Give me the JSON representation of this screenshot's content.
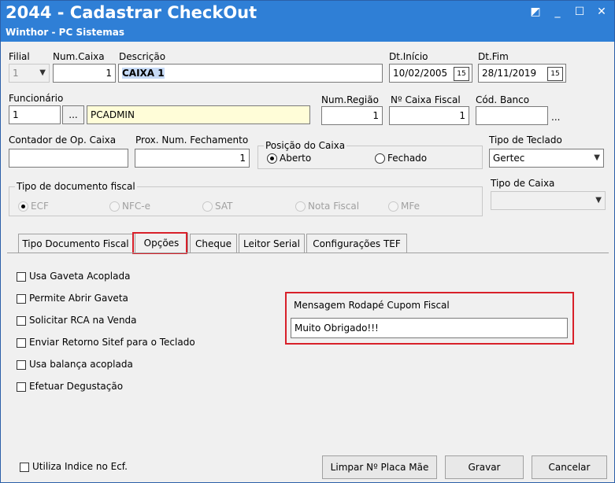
{
  "window": {
    "title": "2044 - Cadastrar CheckOut",
    "subtitle": "Winthor - PC Sistemas",
    "controls": [
      "◩",
      "_",
      "☐",
      "✕"
    ]
  },
  "fields": {
    "filial": {
      "label": "Filial",
      "value": "1"
    },
    "num_caixa": {
      "label": "Num.Caixa",
      "value": "1"
    },
    "descricao": {
      "label": "Descrição",
      "value": "CAIXA 1"
    },
    "dt_inicio": {
      "label": "Dt.Início",
      "value": "10/02/2005"
    },
    "dt_fim": {
      "label": "Dt.Fim",
      "value": "28/11/2019"
    },
    "funcionario": {
      "label": "Funcionário",
      "code": "1",
      "lookup_btn": "...",
      "name": "PCADMIN"
    },
    "num_regiao": {
      "label": "Num.Região",
      "value": "1"
    },
    "num_caixa_fiscal": {
      "label": "Nº Caixa Fiscal",
      "value": "1"
    },
    "cod_banco": {
      "label": "Cód. Banco",
      "value": "",
      "lookup": "..."
    },
    "contador_op_caixa": {
      "label": "Contador de Op. Caixa",
      "value": ""
    },
    "prox_num_fechamento": {
      "label": "Prox. Num. Fechamento",
      "value": "1"
    },
    "tipo_teclado": {
      "label": "Tipo de Teclado",
      "value": "Gertec"
    },
    "tipo_caixa": {
      "label": "Tipo de Caixa",
      "value": ""
    }
  },
  "posicao_caixa": {
    "label": "Posição do Caixa",
    "options": [
      {
        "label": "Aberto",
        "selected": true
      },
      {
        "label": "Fechado",
        "selected": false
      }
    ]
  },
  "tipo_documento_fiscal": {
    "label": "Tipo de documento fiscal",
    "options": [
      {
        "label": "ECF",
        "selected": true
      },
      {
        "label": "NFC-e",
        "selected": false
      },
      {
        "label": "SAT",
        "selected": false
      },
      {
        "label": "Nota Fiscal",
        "selected": false
      },
      {
        "label": "MFe",
        "selected": false
      }
    ]
  },
  "tabs": [
    {
      "label": "Tipo Documento Fiscal",
      "active": false
    },
    {
      "label": "Opções",
      "active": true
    },
    {
      "label": "Cheque",
      "active": false
    },
    {
      "label": "Leitor Serial",
      "active": false
    },
    {
      "label": "Configurações TEF",
      "active": false
    }
  ],
  "opcoes": {
    "checkboxes": [
      {
        "label": "Usa Gaveta Acoplada",
        "checked": false
      },
      {
        "label": "Permite Abrir Gaveta",
        "checked": false
      },
      {
        "label": "Solicitar RCA na Venda",
        "checked": false
      },
      {
        "label": "Enviar Retorno Sitef para o Teclado",
        "checked": false
      },
      {
        "label": "Usa balança acoplada",
        "checked": false
      },
      {
        "label": "Efetuar Degustação",
        "checked": false
      }
    ],
    "mensagem_rodape": {
      "label": "Mensagem Rodapé Cupom Fiscal",
      "value": "Muito Obrigado!!!"
    }
  },
  "footer": {
    "utiliza_indice": {
      "label": "Utiliza Indice no Ecf.",
      "checked": false
    },
    "buttons": {
      "limpar": "Limpar Nº Placa Mãe",
      "gravar": "Gravar",
      "cancelar": "Cancelar"
    }
  },
  "colors": {
    "titlebar": "#2f7fd6",
    "highlight": "#d8202a",
    "selection": "#c6daf6"
  }
}
